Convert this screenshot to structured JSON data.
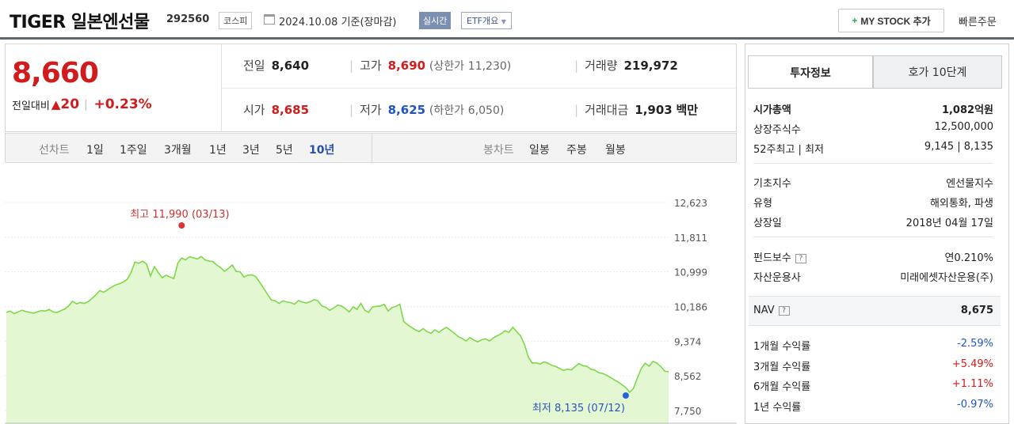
{
  "header": {
    "title": "TIGER 일본엔선물",
    "code": "292560",
    "market": "코스피",
    "date": "2024.10.08 기준(장마감)",
    "live_badge": "실시간",
    "etf_badge": "ETF개요",
    "mystock_label": "MY STOCK 추가",
    "quick_order": "빠른주문"
  },
  "price": {
    "current": "8,660",
    "change_label": "전일대비",
    "change_value": "20",
    "change_pct": "+0.23%"
  },
  "stats": {
    "prev_label": "전일",
    "prev": "8,640",
    "high_label": "고가",
    "high": "8,690",
    "upper_limit_label": "(상한가",
    "upper_limit": "11,230)",
    "volume_label": "거래량",
    "volume": "219,972",
    "open_label": "시가",
    "open": "8,685",
    "low_label": "저가",
    "low": "8,625",
    "lower_limit_label": "(하한가",
    "lower_limit": "6,050)",
    "amount_label": "거래대금",
    "amount": "1,903",
    "amount_unit": "백만"
  },
  "tabs": {
    "line_label": "선차트",
    "periods": [
      "1일",
      "1주일",
      "3개월",
      "1년",
      "3년",
      "5년",
      "10년"
    ],
    "active_period": "10년",
    "candle_label": "봉차트",
    "candles": [
      "일봉",
      "주봉",
      "월봉"
    ]
  },
  "chart_data": {
    "type": "area",
    "yticks": [
      "12,623",
      "11,811",
      "10,999",
      "10,186",
      "9,374",
      "8,562",
      "7,750"
    ],
    "ylim": [
      7750,
      12623
    ],
    "max_label": "최고 11,990 (03/13)",
    "min_label": "최저 8,135 (07/12)",
    "max_index": 45,
    "min_index": 159,
    "color": "#7dd84a",
    "fill": "#e3f8d2",
    "values": [
      10050,
      10080,
      10020,
      10060,
      10100,
      10070,
      10050,
      10030,
      10060,
      10090,
      10080,
      10120,
      10060,
      10050,
      10090,
      10130,
      10200,
      10310,
      10250,
      10280,
      10260,
      10300,
      10380,
      10460,
      10560,
      10520,
      10580,
      10640,
      10690,
      10720,
      10760,
      10820,
      10980,
      11230,
      11200,
      11250,
      11180,
      10900,
      11120,
      10980,
      10860,
      10920,
      10880,
      10840,
      11200,
      11320,
      11280,
      11350,
      11330,
      11300,
      11360,
      11280,
      11250,
      11240,
      11160,
      11100,
      11010,
      11080,
      11160,
      11010,
      11000,
      10880,
      10920,
      10930,
      10890,
      10760,
      10620,
      10480,
      10340,
      10320,
      10260,
      10320,
      10290,
      10280,
      10240,
      10330,
      10290,
      10270,
      10300,
      10350,
      10320,
      10200,
      10170,
      10100,
      10150,
      10220,
      10200,
      10140,
      10060,
      10180,
      10120,
      10260,
      10100,
      10050,
      10180,
      10190,
      10200,
      10240,
      10080,
      10160,
      10190,
      10240,
      9840,
      9760,
      9700,
      9640,
      9600,
      9670,
      9600,
      9560,
      9640,
      9580,
      9650,
      9700,
      9630,
      9560,
      9480,
      9440,
      9380,
      9460,
      9400,
      9360,
      9410,
      9430,
      9380,
      9450,
      9500,
      9550,
      9620,
      9580,
      9700,
      9600,
      9500,
      9300,
      9000,
      8860,
      8870,
      8840,
      8890,
      8860,
      8810,
      8780,
      8740,
      8690,
      8720,
      8700,
      8780,
      8850,
      8800,
      8790,
      8720,
      8700,
      8640,
      8620,
      8580,
      8530,
      8470,
      8420,
      8360,
      8290,
      8180,
      8270,
      8520,
      8740,
      8860,
      8790,
      8900,
      8860,
      8780,
      8670,
      8660
    ]
  },
  "info": {
    "tab_invest": "투자정보",
    "tab_hoga": "호가 10단계",
    "mktcap_label": "시가총액",
    "mktcap": "1,082억원",
    "shares_label": "상장주식수",
    "shares": "12,500,000",
    "w52_label": "52주최고 | 최저",
    "w52": "9,145 | 8,135",
    "index_label": "기초지수",
    "index": "엔선물지수",
    "type_label": "유형",
    "type": "해외통화, 파생",
    "listed_label": "상장일",
    "listed": "2018년 04월 17일",
    "fee_label": "펀드보수",
    "fee": "연0.210%",
    "manager_label": "자산운용사",
    "manager": "미래에셋자산운용(주)",
    "nav_label": "NAV",
    "nav": "8,675",
    "r1m_label": "1개월 수익률",
    "r1m": "-2.59%",
    "r3m_label": "3개월 수익률",
    "r3m": "+5.49%",
    "r6m_label": "6개월 수익률",
    "r6m": "+1.11%",
    "r1y_label": "1년 수익률",
    "r1y": "-0.97%"
  }
}
